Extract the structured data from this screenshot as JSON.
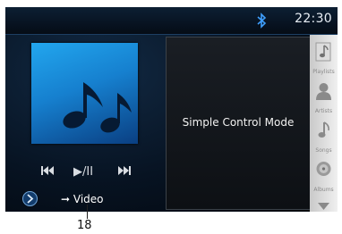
{
  "status_bar": {
    "time": "22:30",
    "bluetooth_icon": "bluetooth-icon"
  },
  "album_art": {
    "icon": "music-note-icon",
    "colors": {
      "top": "#22a6ee",
      "bottom": "#0a3f82"
    }
  },
  "controls": {
    "prev_icon": "skip-previous-icon",
    "play_pause_label": "▶/II",
    "next_icon": "skip-next-icon"
  },
  "mode_panel": {
    "text": "Simple Control Mode"
  },
  "bottom": {
    "nav_button_icon": "chevron-right-icon",
    "video_label": "➞ Video"
  },
  "sidebar": {
    "items": [
      {
        "label": "Playlists",
        "icon": "playlist-icon"
      },
      {
        "label": "Artists",
        "icon": "artist-icon"
      },
      {
        "label": "Songs",
        "icon": "song-icon"
      },
      {
        "label": "Albums",
        "icon": "album-icon"
      }
    ],
    "scroll_icon": "chevron-down-icon"
  },
  "callout": {
    "number": "18"
  }
}
